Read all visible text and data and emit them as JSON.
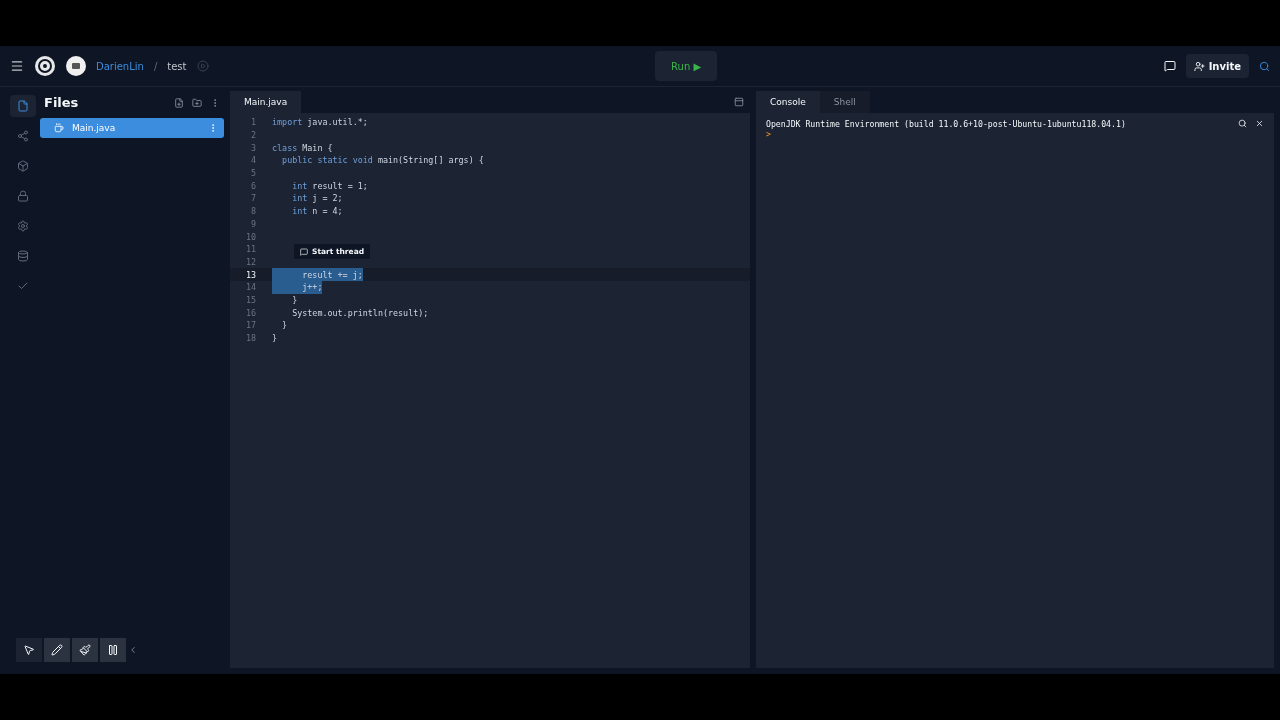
{
  "topbar": {
    "user": "DarienLin",
    "separator": "/",
    "repl": "test",
    "run_label": "Run ▶",
    "invite_label": "Invite"
  },
  "rail": [
    {
      "kind": "file",
      "selected": true
    },
    {
      "kind": "share",
      "selected": false
    },
    {
      "kind": "cube",
      "selected": false
    },
    {
      "kind": "lock",
      "selected": false
    },
    {
      "kind": "gear",
      "selected": false
    },
    {
      "kind": "database",
      "selected": false
    },
    {
      "kind": "check",
      "selected": false
    }
  ],
  "files": {
    "title": "Files",
    "items": [
      {
        "name": "Main.java",
        "selected": true
      }
    ]
  },
  "editor": {
    "tab": "Main.java",
    "tooltip": "Start thread",
    "lines": [
      {
        "n": "1",
        "tokens": [
          {
            "t": "import ",
            "kind": "kw"
          },
          {
            "t": "java.util.*;",
            "kind": "plain"
          }
        ],
        "selected": false,
        "active": false
      },
      {
        "n": "2",
        "selected": false,
        "active": false
      },
      {
        "n": "3",
        "tokens": [
          {
            "t": "class ",
            "kind": "kw"
          },
          {
            "t": "Main {",
            "kind": "plain"
          }
        ],
        "selected": false,
        "active": false
      },
      {
        "n": "4",
        "tokens": [
          {
            "t": "  public static void ",
            "kind": "kw"
          },
          {
            "t": "main(String[] args) {",
            "kind": "plain"
          }
        ],
        "selected": false,
        "active": false
      },
      {
        "n": "5",
        "selected": false,
        "active": false
      },
      {
        "n": "6",
        "tokens": [
          {
            "t": "    int ",
            "kind": "kw"
          },
          {
            "t": "result = 1;",
            "kind": "plain"
          }
        ],
        "selected": false,
        "active": false
      },
      {
        "n": "7",
        "tokens": [
          {
            "t": "    int ",
            "kind": "kw"
          },
          {
            "t": "j = 2;",
            "kind": "plain"
          }
        ],
        "selected": false,
        "active": false
      },
      {
        "n": "8",
        "tokens": [
          {
            "t": "    int ",
            "kind": "kw"
          },
          {
            "t": "n = 4;",
            "kind": "plain"
          }
        ],
        "selected": false,
        "active": false
      },
      {
        "n": "9",
        "selected": false,
        "active": false
      },
      {
        "n": "10",
        "selected": false,
        "active": false
      },
      {
        "n": "11",
        "selected": false,
        "active": false
      },
      {
        "n": "12",
        "selected": false,
        "active": false
      },
      {
        "n": "13",
        "tokens": [
          {
            "t": "      result += j;",
            "kind": "plain"
          }
        ],
        "selected": true,
        "active": true
      },
      {
        "n": "14",
        "tokens": [
          {
            "t": "      j++;",
            "kind": "plain"
          }
        ],
        "selected": true,
        "active": false
      },
      {
        "n": "15",
        "tokens": [
          {
            "t": "    }",
            "kind": "plain"
          }
        ],
        "selected": false,
        "active": false
      },
      {
        "n": "16",
        "tokens": [
          {
            "t": "    System.out.println(result);",
            "kind": "plain"
          }
        ],
        "selected": false,
        "active": false
      },
      {
        "n": "17",
        "tokens": [
          {
            "t": "  }",
            "kind": "plain"
          }
        ],
        "selected": false,
        "active": false
      },
      {
        "n": "18",
        "tokens": [
          {
            "t": "}",
            "kind": "plain"
          }
        ],
        "selected": false,
        "active": false
      }
    ]
  },
  "console": {
    "tabs": [
      {
        "label": "Console",
        "selected": true
      },
      {
        "label": "Shell",
        "selected": false
      }
    ],
    "output": "OpenJDK Runtime Environment (build 11.0.6+10-post-Ubuntu-1ubuntu118.04.1)",
    "prompt": ">"
  },
  "tools": [
    {
      "kind": "pointer",
      "selected": true
    },
    {
      "kind": "pencil",
      "selected": false
    },
    {
      "kind": "broom",
      "selected": false
    },
    {
      "kind": "pause",
      "selected": false
    }
  ]
}
